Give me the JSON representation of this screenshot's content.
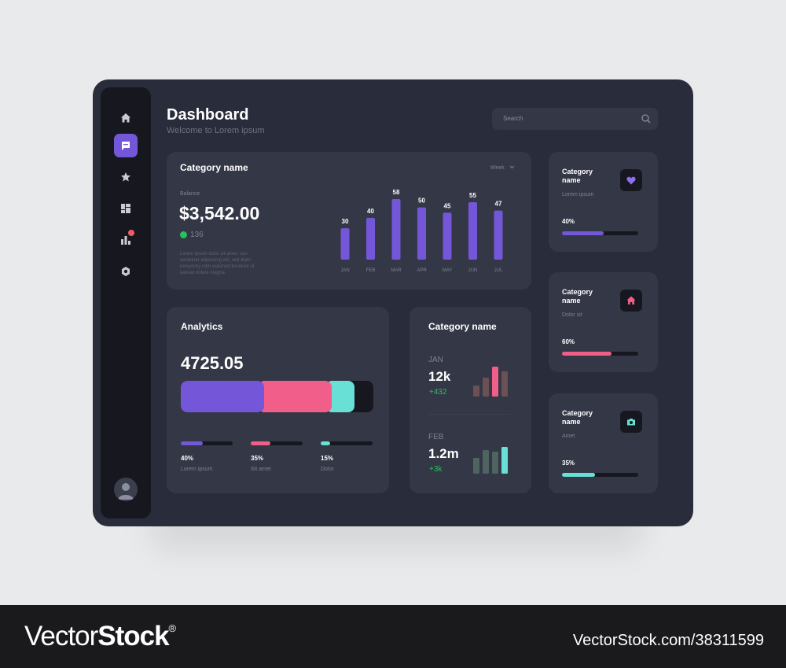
{
  "header": {
    "title": "Dashboard",
    "subtitle": "Welcome to Lorem ipsum"
  },
  "search": {
    "placeholder": "Search"
  },
  "sidebar": {
    "items": [
      {
        "icon": "home-icon",
        "active": false
      },
      {
        "icon": "message-icon",
        "active": true
      },
      {
        "icon": "star-icon",
        "active": false
      },
      {
        "icon": "grid-layout-icon",
        "active": false
      },
      {
        "icon": "bar-chart-icon",
        "active": false,
        "badge": true
      },
      {
        "icon": "settings-icon",
        "active": false
      }
    ],
    "avatar_icon": "user-avatar-icon"
  },
  "balance_card": {
    "title": "Category name",
    "period": "Week",
    "balance_label": "Balance",
    "balance_value": "$3,542.00",
    "delta": "136",
    "description": "Lorem ipsum dolor sit amet, con- sectetuer adipiscing elit, sed diam nonummy nibh euismod tincidunt ut laoreet dolore magna."
  },
  "analytics_card": {
    "title": "Analytics",
    "value": "4725.05",
    "segments": [
      {
        "name": "Lorem ipsum",
        "percent_label": "40%",
        "value": 40,
        "color": "#7357d8"
      },
      {
        "name": "Sit amet",
        "percent_label": "35%",
        "value": 35,
        "color": "#f15e8a"
      },
      {
        "name": "Dolor",
        "percent_label": "15%",
        "value": 15,
        "color": "#69e0d5"
      }
    ]
  },
  "monthly_card": {
    "title": "Category name",
    "rows": [
      {
        "month": "JAN",
        "value": "12k",
        "delta": "+432",
        "bars": [
          14,
          24,
          38,
          32
        ],
        "colors": [
          "#6b5055",
          "#6b5055",
          "#f15e8a",
          "#6b5055"
        ]
      },
      {
        "month": "FEB",
        "value": "1.2m",
        "delta": "+3k",
        "bars": [
          20,
          30,
          28,
          34
        ],
        "colors": [
          "#4f6361",
          "#4f6361",
          "#4f6361",
          "#69e0d5"
        ]
      }
    ]
  },
  "category_cards": [
    {
      "title": "Category name",
      "subtitle": "Lorem ipsum",
      "percent_label": "40%",
      "progress": 0.55,
      "icon": "heart-icon",
      "color": "#7357d8"
    },
    {
      "title": "Category name",
      "subtitle": "Dolor sit",
      "percent_label": "60%",
      "progress": 0.65,
      "icon": "home-icon",
      "color": "#f15e8a"
    },
    {
      "title": "Category name",
      "subtitle": "Amet",
      "percent_label": "35%",
      "progress": 0.43,
      "icon": "camera-icon",
      "color": "#69e0d5"
    }
  ],
  "chart_data": {
    "type": "bar",
    "categories": [
      "JAN",
      "FEB",
      "MAR",
      "APR",
      "MAY",
      "JUN",
      "JUL"
    ],
    "values": [
      30,
      40,
      58,
      50,
      45,
      55,
      47
    ],
    "title": "",
    "xlabel": "",
    "ylabel": "",
    "ylim": [
      0,
      58
    ],
    "color": "#7357d8"
  },
  "watermark": {
    "brand_regular": "Vector",
    "brand_bold": "Stock",
    "registered": "®",
    "url": "VectorStock.com/38311599"
  }
}
